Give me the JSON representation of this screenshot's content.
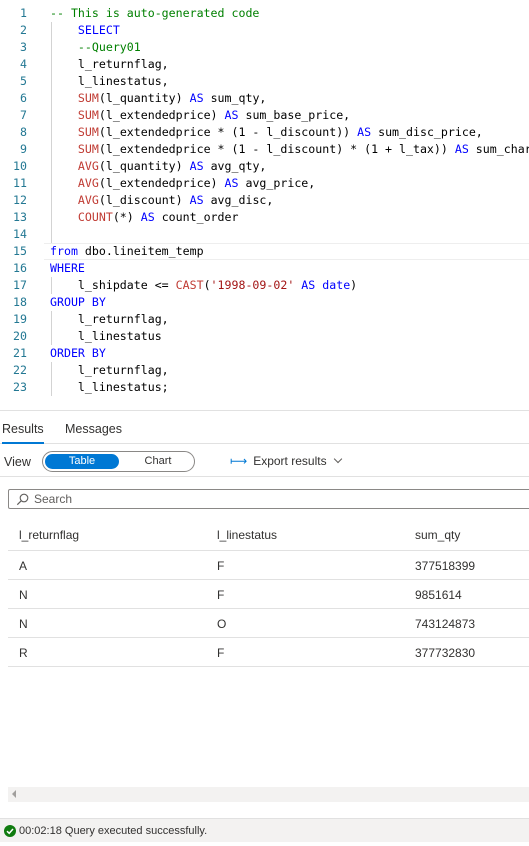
{
  "editor": {
    "lines": [
      {
        "n": "1",
        "segs": [
          [
            "cmt",
            "-- This is auto-generated code"
          ]
        ]
      },
      {
        "n": "2",
        "segs": [
          [
            "txt",
            "    "
          ],
          [
            "kw",
            "SELECT"
          ]
        ]
      },
      {
        "n": "3",
        "segs": [
          [
            "txt",
            "    "
          ],
          [
            "cmt",
            "--Query01"
          ]
        ]
      },
      {
        "n": "4",
        "segs": [
          [
            "txt",
            "    l_returnflag,"
          ]
        ]
      },
      {
        "n": "5",
        "segs": [
          [
            "txt",
            "    l_linestatus,"
          ]
        ]
      },
      {
        "n": "6",
        "segs": [
          [
            "txt",
            "    "
          ],
          [
            "fn",
            "SUM"
          ],
          [
            "txt",
            "(l_quantity) "
          ],
          [
            "kw",
            "AS"
          ],
          [
            "txt",
            " sum_qty,"
          ]
        ]
      },
      {
        "n": "7",
        "segs": [
          [
            "txt",
            "    "
          ],
          [
            "fn",
            "SUM"
          ],
          [
            "txt",
            "(l_extendedprice) "
          ],
          [
            "kw",
            "AS"
          ],
          [
            "txt",
            " sum_base_price,"
          ]
        ]
      },
      {
        "n": "8",
        "segs": [
          [
            "txt",
            "    "
          ],
          [
            "fn",
            "SUM"
          ],
          [
            "txt",
            "(l_extendedprice * (1 - l_discount)) "
          ],
          [
            "kw",
            "AS"
          ],
          [
            "txt",
            " sum_disc_price,"
          ]
        ]
      },
      {
        "n": "9",
        "segs": [
          [
            "txt",
            "    "
          ],
          [
            "fn",
            "SUM"
          ],
          [
            "txt",
            "(l_extendedprice * (1 - l_discount) * (1 + l_tax)) "
          ],
          [
            "kw",
            "AS"
          ],
          [
            "txt",
            " sum_charge,"
          ]
        ]
      },
      {
        "n": "10",
        "segs": [
          [
            "txt",
            "    "
          ],
          [
            "fn",
            "AVG"
          ],
          [
            "txt",
            "(l_quantity) "
          ],
          [
            "kw",
            "AS"
          ],
          [
            "txt",
            " avg_qty,"
          ]
        ]
      },
      {
        "n": "11",
        "segs": [
          [
            "txt",
            "    "
          ],
          [
            "fn",
            "AVG"
          ],
          [
            "txt",
            "(l_extendedprice) "
          ],
          [
            "kw",
            "AS"
          ],
          [
            "txt",
            " avg_price,"
          ]
        ]
      },
      {
        "n": "12",
        "segs": [
          [
            "txt",
            "    "
          ],
          [
            "fn",
            "AVG"
          ],
          [
            "txt",
            "(l_discount) "
          ],
          [
            "kw",
            "AS"
          ],
          [
            "txt",
            " avg_disc,"
          ]
        ]
      },
      {
        "n": "13",
        "segs": [
          [
            "txt",
            "    "
          ],
          [
            "fn",
            "COUNT"
          ],
          [
            "txt",
            "(*) "
          ],
          [
            "kw",
            "AS"
          ],
          [
            "txt",
            " count_order"
          ]
        ]
      },
      {
        "n": "14",
        "segs": []
      },
      {
        "n": "15",
        "segs": [
          [
            "kw",
            "from"
          ],
          [
            "txt",
            " dbo.lineitem_temp"
          ]
        ]
      },
      {
        "n": "16",
        "segs": [
          [
            "kw",
            "WHERE"
          ]
        ]
      },
      {
        "n": "17",
        "segs": [
          [
            "txt",
            "    l_shipdate <= "
          ],
          [
            "fn",
            "CAST"
          ],
          [
            "txt",
            "("
          ],
          [
            "str",
            "'1998-09-02'"
          ],
          [
            "txt",
            " "
          ],
          [
            "kw",
            "AS"
          ],
          [
            "txt",
            " "
          ],
          [
            "kw",
            "date"
          ],
          [
            "txt",
            ")"
          ]
        ]
      },
      {
        "n": "18",
        "segs": [
          [
            "kw",
            "GROUP BY"
          ]
        ]
      },
      {
        "n": "19",
        "segs": [
          [
            "txt",
            "    l_returnflag,"
          ]
        ]
      },
      {
        "n": "20",
        "segs": [
          [
            "txt",
            "    l_linestatus"
          ]
        ]
      },
      {
        "n": "21",
        "segs": [
          [
            "kw",
            "ORDER BY"
          ]
        ]
      },
      {
        "n": "22",
        "segs": [
          [
            "txt",
            "    l_returnflag,"
          ]
        ]
      },
      {
        "n": "23",
        "segs": [
          [
            "txt",
            "    l_linestatus;"
          ]
        ]
      }
    ]
  },
  "results": {
    "tabs": [
      "Results",
      "Messages"
    ],
    "active_tab": "Results",
    "view_label": "View",
    "toggle": {
      "table": "Table",
      "chart": "Chart"
    },
    "export_label": "Export results",
    "search_placeholder": "Search",
    "columns": [
      "l_returnflag",
      "l_linestatus",
      "sum_qty"
    ],
    "rows": [
      [
        "A",
        "F",
        "377518399"
      ],
      [
        "N",
        "F",
        "9851614"
      ],
      [
        "N",
        "O",
        "743124873"
      ],
      [
        "R",
        "F",
        "377732830"
      ]
    ]
  },
  "status": {
    "elapsed": "00:02:18",
    "message": "Query executed successfully."
  },
  "colors": {
    "accent": "#0078d4",
    "keyword": "#0000ff",
    "function": "#c03b33",
    "string": "#a31515",
    "comment": "#008000",
    "success": "#107c10"
  }
}
